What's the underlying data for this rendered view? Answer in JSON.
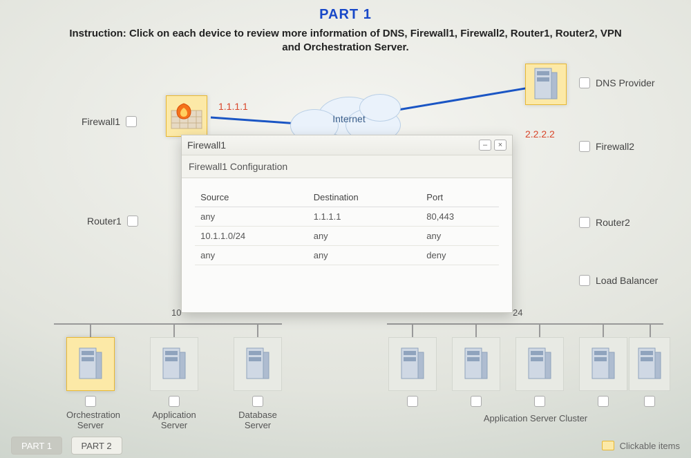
{
  "header": {
    "title": "PART 1",
    "instruction": "Instruction: Click on each device to review more information of DNS, Firewall1, Firewall2, Router1, Router2, VPN and Orchestration Server."
  },
  "labels": {
    "firewall1": "Firewall1",
    "firewall2": "Firewall2",
    "router1": "Router1",
    "router2": "Router2",
    "dns_provider": "DNS Provider",
    "load_balancer": "Load Balancer",
    "internet": "Internet"
  },
  "ips": {
    "firewall1": "1.1.1.1",
    "firewall2": "2.2.2.2",
    "subnet_left_fragment": "10",
    "subnet_right_fragment": "24"
  },
  "popup": {
    "title": "Firewall1",
    "subtitle": "Firewall1 Configuration",
    "columns": {
      "c1": "Source",
      "c2": "Destination",
      "c3": "Port"
    },
    "rows": [
      {
        "source": "any",
        "destination": "1.1.1.1",
        "port": "80,443"
      },
      {
        "source": "10.1.1.0/24",
        "destination": "any",
        "port": "any"
      },
      {
        "source": "any",
        "destination": "any",
        "port": "deny"
      }
    ]
  },
  "bottom_devices": {
    "orchestration": "Orchestration Server",
    "app_server": "Application Server",
    "db_server": "Database Server",
    "app_cluster": "Application Server Cluster"
  },
  "tabs": {
    "part1": "PART 1",
    "part2": "PART 2"
  },
  "legend": {
    "clickable": "Clickable items"
  }
}
